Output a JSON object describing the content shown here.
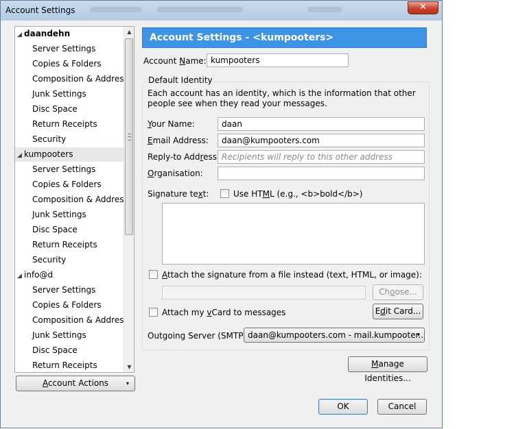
{
  "window": {
    "title": "Account Settings",
    "close_glyph": "✕"
  },
  "tree": {
    "accounts": [
      {
        "name": "daandehn",
        "bold": true,
        "selected": false,
        "items": [
          "Server Settings",
          "Copies & Folders",
          "Composition & Addres...",
          "Junk Settings",
          "Disc Space",
          "Return Receipts",
          "Security"
        ]
      },
      {
        "name": "kumpooters",
        "bold": false,
        "selected": true,
        "items": [
          "Server Settings",
          "Copies & Folders",
          "Composition & Addres...",
          "Junk Settings",
          "Disc Space",
          "Return Receipts",
          "Security"
        ]
      },
      {
        "name": "info@d",
        "bold": false,
        "selected": false,
        "items": [
          "Server Settings",
          "Copies & Folders",
          "Composition & Addres...",
          "Junk Settings",
          "Disc Space",
          "Return Receipts"
        ]
      }
    ],
    "expand_glyph": "◢",
    "scroll_up_glyph": "▲",
    "scroll_down_glyph": "▼"
  },
  "account_actions": {
    "label": "Account Actions",
    "accel": "A",
    "caret": "▾"
  },
  "header": {
    "title": "Account Settings - <kumpooters>"
  },
  "account_name": {
    "label_pre": "Account ",
    "label_accel": "N",
    "label_post": "ame:",
    "value": "kumpooters"
  },
  "identity": {
    "legend": "Default Identity",
    "description": "Each account has an identity, which is the information that other people see when they read your messages.",
    "your_name": {
      "accel": "Y",
      "rest": "our Name:",
      "value": "daan"
    },
    "email": {
      "pre": "",
      "accel": "E",
      "rest": "mail Address:",
      "value": "daan@kumpooters.com"
    },
    "reply_to": {
      "pre": "Reply-to Add",
      "accel": "r",
      "rest": "ess:",
      "value": "",
      "placeholder": "Recipients will reply to this other address"
    },
    "organisation": {
      "accel": "O",
      "rest": "rganisation:",
      "value": ""
    },
    "signature": {
      "pre": "Signature te",
      "accel": "x",
      "rest": "t:"
    },
    "use_html": {
      "pre": "Use HT",
      "accel": "M",
      "rest": "L (e.g., <b>bold</b>)"
    },
    "attach_sig": {
      "accel": "A",
      "rest": "ttach the signature from a file instead (text, HTML, or image):"
    },
    "choose_button": {
      "pre": "Ch",
      "accel": "o",
      "rest": "ose..."
    },
    "attach_vcard": {
      "pre": "Attach my ",
      "accel": "v",
      "rest": "Card to messages"
    },
    "edit_card_button": {
      "pre": "E",
      "accel": "d",
      "rest": "it Card..."
    },
    "outgoing": {
      "label": "Outgoing Server (SMTP):",
      "value": "daan@kumpooters.com - mail.kumpooter...",
      "caret": "▾"
    }
  },
  "manage_identities": {
    "accel": "M",
    "rest": "anage Identities..."
  },
  "ok_label": "OK",
  "cancel_label": "Cancel"
}
